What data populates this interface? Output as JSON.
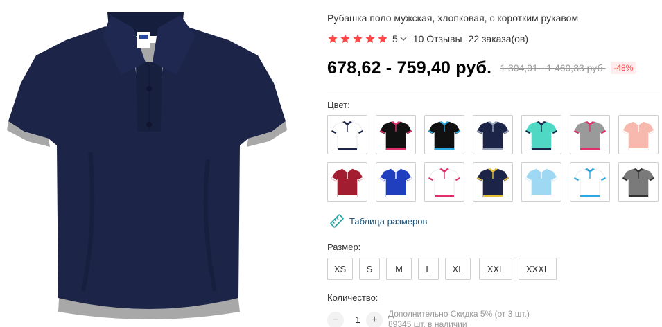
{
  "product": {
    "title": "Рубашка поло мужская, хлопковая, с коротким рукавом",
    "main_color": "#1c2548",
    "accent_color": "#a6a6a6"
  },
  "rating": {
    "value": "5",
    "stars": 5,
    "reviews": "10 Отзывы",
    "orders": "22 заказа(ов)",
    "star_color": "#ff4747"
  },
  "price": {
    "current": "678,62 - 759,40 руб.",
    "original": "1 304,91 - 1 460,33 руб.",
    "discount": "-48%"
  },
  "color_section": {
    "label": "Цвет:",
    "options": [
      {
        "body": "#ffffff",
        "trim": "#1c2548"
      },
      {
        "body": "#111111",
        "trim": "#e0306a"
      },
      {
        "body": "#111111",
        "trim": "#2aa8e0"
      },
      {
        "body": "#1c2548",
        "trim": "#9aa4b8"
      },
      {
        "body": "#4fd8c4",
        "trim": "#1c2548"
      },
      {
        "body": "#9a9a9a",
        "trim": "#e0306a"
      },
      {
        "body": "#f7b9ad",
        "trim": "#ffffff"
      },
      {
        "body": "#a21d2f",
        "trim": "#ffffff"
      },
      {
        "body": "#1f3fbf",
        "trim": "#ffffff"
      },
      {
        "body": "#ffffff",
        "trim": "#e0306a"
      },
      {
        "body": "#1c2548",
        "trim": "#e8c23a"
      },
      {
        "body": "#9fd8f2",
        "trim": "#ffffff"
      },
      {
        "body": "#ffffff",
        "trim": "#2aa8e0"
      },
      {
        "body": "#7a7a7a",
        "trim": "#333333"
      }
    ]
  },
  "size_chart": {
    "label": "Таблица размеров",
    "icon": "ruler-icon",
    "color": "#2aa5a0"
  },
  "size_section": {
    "label": "Размер:",
    "options": [
      "XS",
      "S",
      "M",
      "L",
      "XL",
      "XXL",
      "XXXL"
    ]
  },
  "quantity": {
    "label": "Количество:",
    "minus": "−",
    "plus": "+",
    "value": "1",
    "extra_discount": "Дополнительно Скидка 5% (от 3 шт.)",
    "stock": "89345 шт. в наличии"
  }
}
